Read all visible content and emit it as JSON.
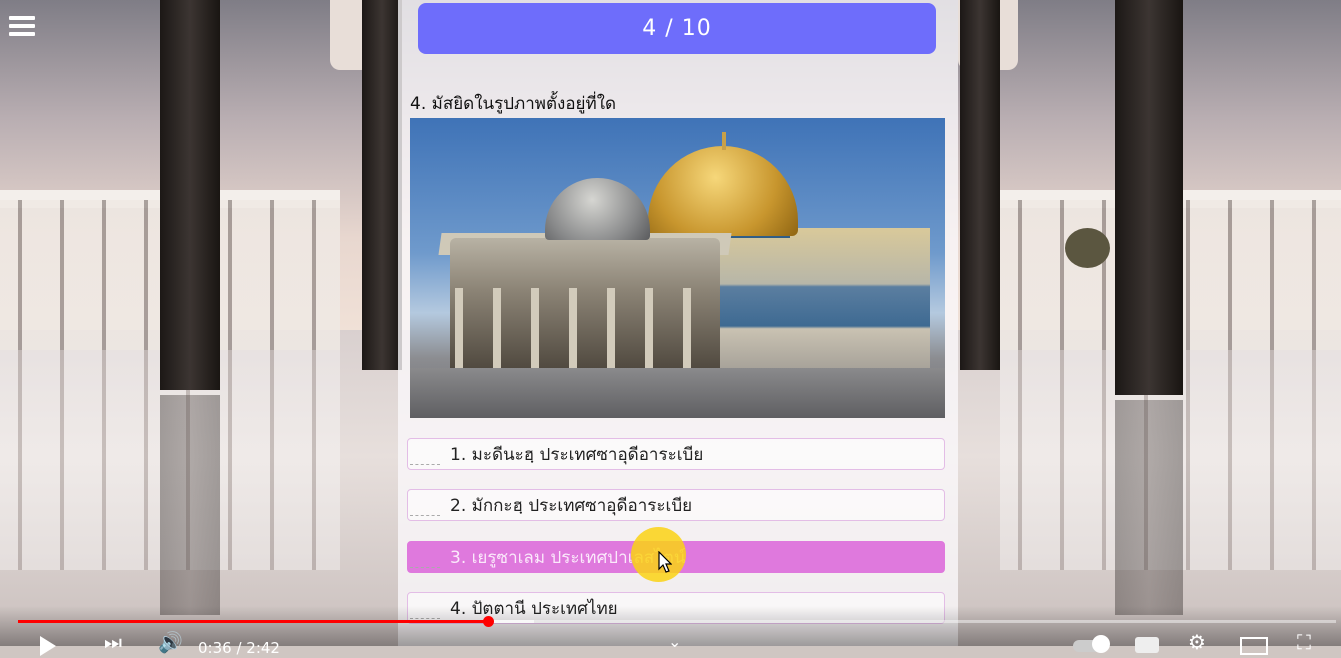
{
  "quiz": {
    "progress": "4 / 10",
    "question": "4. มัสยิดในรูปภาพตั้งอยู่ที่ใด",
    "options": [
      {
        "label": "1. มะดีนะฮฺ ประเทศซาอุดีอาระเบีย",
        "selected": false
      },
      {
        "label": "2. มักกะฮฺ ประเทศซาอุดีอาระเบีย",
        "selected": false
      },
      {
        "label": "3. เยรูซาเลม ประเทศปาเลสไตน์",
        "selected": true
      },
      {
        "label": "4. ปัตตานี ประเทศไทย",
        "selected": false
      }
    ]
  },
  "player": {
    "time": "0:36 / 2:42",
    "progress_fraction": 0.36
  },
  "icons": {
    "menu": "hamburger-menu-icon",
    "play": "play-icon",
    "next": "next-icon",
    "volume": "volume-icon",
    "settings": "gear-icon",
    "fullscreen": "fullscreen-icon"
  },
  "colors": {
    "progress_bar": "#6e6dfb",
    "selected_option": "#df79dd",
    "seek_played": "#ff0000"
  }
}
